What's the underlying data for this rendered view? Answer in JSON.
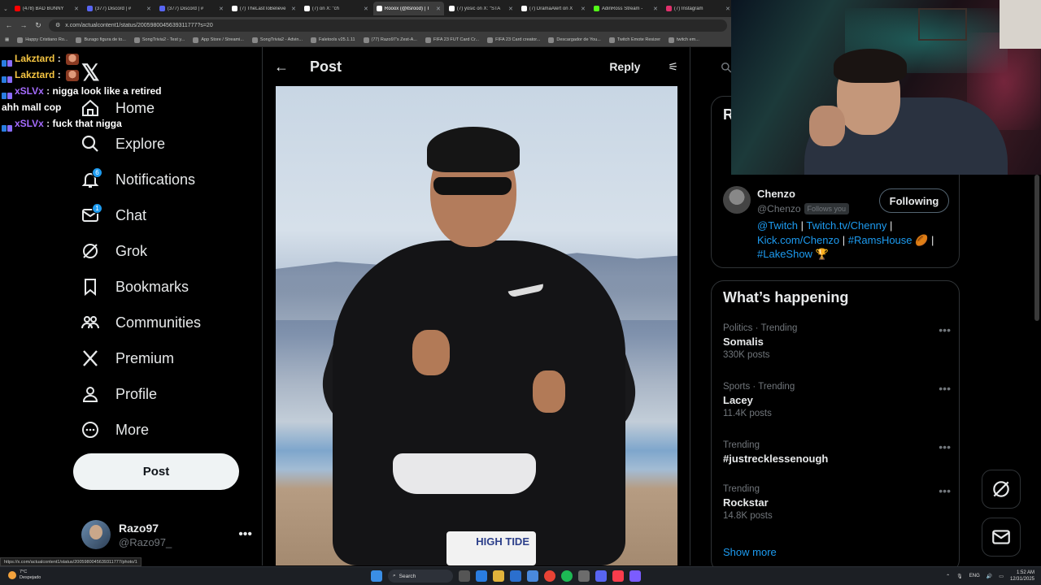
{
  "browser": {
    "tabs": [
      {
        "label": "(478) BAD BUNNY",
        "color": "#ff0000"
      },
      {
        "label": "(377) Discord | #",
        "color": "#5865f2"
      },
      {
        "label": "(377) Discord | #",
        "color": "#5865f2"
      },
      {
        "label": "(7) TheLastToBelieve",
        "color": "#ffffff"
      },
      {
        "label": "(7) on X: \"ch",
        "color": "#ffffff"
      },
      {
        "label": "Rooox (@itsrood) | T",
        "color": "#ffffff"
      },
      {
        "label": "(7) yosic on X: \"STA",
        "color": "#ffffff"
      },
      {
        "label": "(7) DramaAlert on X",
        "color": "#ffffff"
      },
      {
        "label": "AdinRoss Stream - ",
        "color": "#53fc18"
      },
      {
        "label": "(7) Instagram",
        "color": "#e1306c"
      }
    ],
    "url": "x.com/actualcontent1/status/2005980045639311777?s=20",
    "bookmarks": [
      "Happy Cristiano Ro...",
      "Burago figura de to...",
      "SongTrivia2 - Test y...",
      "App Store / Streami...",
      "SongTrivia2 - Advin...",
      "Faletools v25.1.11",
      "(77) Razo97's Zest-A...",
      "FIFA 23 FUT Card Cr...",
      "FIFA 23 Card creator...",
      "Descargador de You...",
      "Twitch Emote Resizer",
      "twitch em..."
    ],
    "status_url": "https://x.com/actualcontent1/status/2005980045639311777/photo/1"
  },
  "chat": [
    {
      "user": "Lakztard",
      "message": "",
      "emote": true,
      "color": "#f5c542"
    },
    {
      "user": "Lakztard",
      "message": "",
      "emote": true,
      "color": "#f5c542"
    },
    {
      "user": "xSLVx",
      "message": "nigga look like a retired ahh mall cop",
      "emote": false,
      "color": "#a56cff"
    },
    {
      "user": "xSLVx",
      "message": "fuck that nigga",
      "emote": false,
      "color": "#a56cff"
    }
  ],
  "nav": {
    "items": [
      {
        "label": "Home",
        "icon": "home-icon",
        "badge": ""
      },
      {
        "label": "Explore",
        "icon": "search-icon",
        "badge": ""
      },
      {
        "label": "Notifications",
        "icon": "bell-icon",
        "badge": "6"
      },
      {
        "label": "Chat",
        "icon": "mail-icon",
        "badge": "1"
      },
      {
        "label": "Grok",
        "icon": "grok-icon",
        "badge": ""
      },
      {
        "label": "Bookmarks",
        "icon": "bookmark-icon",
        "badge": ""
      },
      {
        "label": "Communities",
        "icon": "communities-icon",
        "badge": ""
      },
      {
        "label": "Premium",
        "icon": "x-logo-icon",
        "badge": ""
      },
      {
        "label": "Profile",
        "icon": "person-icon",
        "badge": ""
      },
      {
        "label": "More",
        "icon": "more-circle-icon",
        "badge": ""
      }
    ],
    "post_label": "Post",
    "account": {
      "name": "Razo97",
      "handle": "@Razo97_"
    }
  },
  "post": {
    "header_title": "Post",
    "reply_label": "Reply",
    "bib_text": "HIGH TIDE"
  },
  "sidebar": {
    "relevant_heading": "R",
    "person": {
      "name": "Chenzo",
      "handle": "@Chenzo",
      "follows_you": "Follows you",
      "follow_label": "Following",
      "bio": [
        {
          "t": "@Twitch",
          "link": true
        },
        {
          "t": " | ",
          "link": false
        },
        {
          "t": "Twitch.tv/Chenny",
          "link": true
        },
        {
          "t": " | ",
          "link": false
        },
        {
          "t": "Kick.com/Chenzo",
          "link": true
        },
        {
          "t": " | ",
          "link": false
        },
        {
          "t": "#RamsHouse",
          "link": true
        },
        {
          "t": " 🏉 | ",
          "link": false
        },
        {
          "t": "#LakeShow",
          "link": true
        },
        {
          "t": " 🏆",
          "link": false
        }
      ]
    },
    "trending_heading": "What’s happening",
    "trends": [
      {
        "meta": "Politics · Trending",
        "name": "Somalis",
        "count": "330K posts"
      },
      {
        "meta": "Sports · Trending",
        "name": "Lacey",
        "count": "11.4K posts"
      },
      {
        "meta": "Trending",
        "name": "#justrecklessenough",
        "count": ""
      },
      {
        "meta": "Trending",
        "name": "Rockstar",
        "count": "14.8K posts"
      }
    ],
    "show_more": "Show more"
  },
  "taskbar": {
    "weather_temp": "7°C",
    "weather_desc": "Despejado",
    "search": "Search",
    "lang": "ENG",
    "time": "1:52 AM",
    "date": "12/31/2025"
  }
}
